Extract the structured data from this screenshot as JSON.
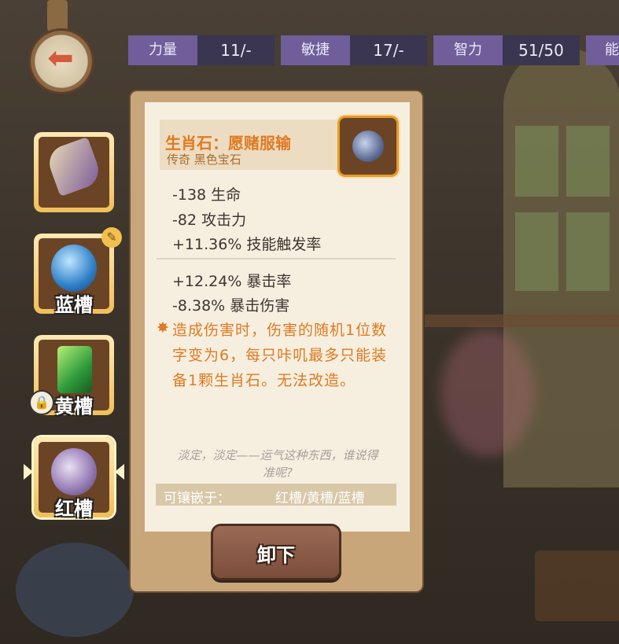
{
  "stats": [
    {
      "label": "力量",
      "value": "11/-"
    },
    {
      "label": "敏捷",
      "value": "17/-"
    },
    {
      "label": "智力",
      "value": "51/50"
    },
    {
      "label": "能",
      "value": ""
    }
  ],
  "slots": {
    "slot2_label": "蓝槽",
    "slot3_label": "黄槽",
    "slot4_label": "红槽"
  },
  "item": {
    "title": "生肖石：愿赌服输",
    "subtitle": "传奇 黑色宝石",
    "base_stats": [
      "-138 生命",
      "-82 攻击力",
      "+11.36% 技能触发率"
    ],
    "extra_stats": [
      "+12.24% 暴击率",
      "-8.38% 暴击伤害"
    ],
    "effect_lines": [
      "造成伤害时，伤害的随机1位数",
      "字变为6，每只咔叽最多只能装",
      "备1颗生肖石。无法改造。"
    ],
    "flavor_lines": [
      "淡定，淡定——运气这种东西，谁说得",
      "准呢?"
    ],
    "socket_label": "可镶嵌于：",
    "socket_value": "红槽/黄槽/蓝槽"
  },
  "unequip_label": "卸下",
  "colors": {
    "accent": "#e07a22",
    "stat_label_bg": "#6f5e9a",
    "stat_value_bg": "#3a3550"
  }
}
